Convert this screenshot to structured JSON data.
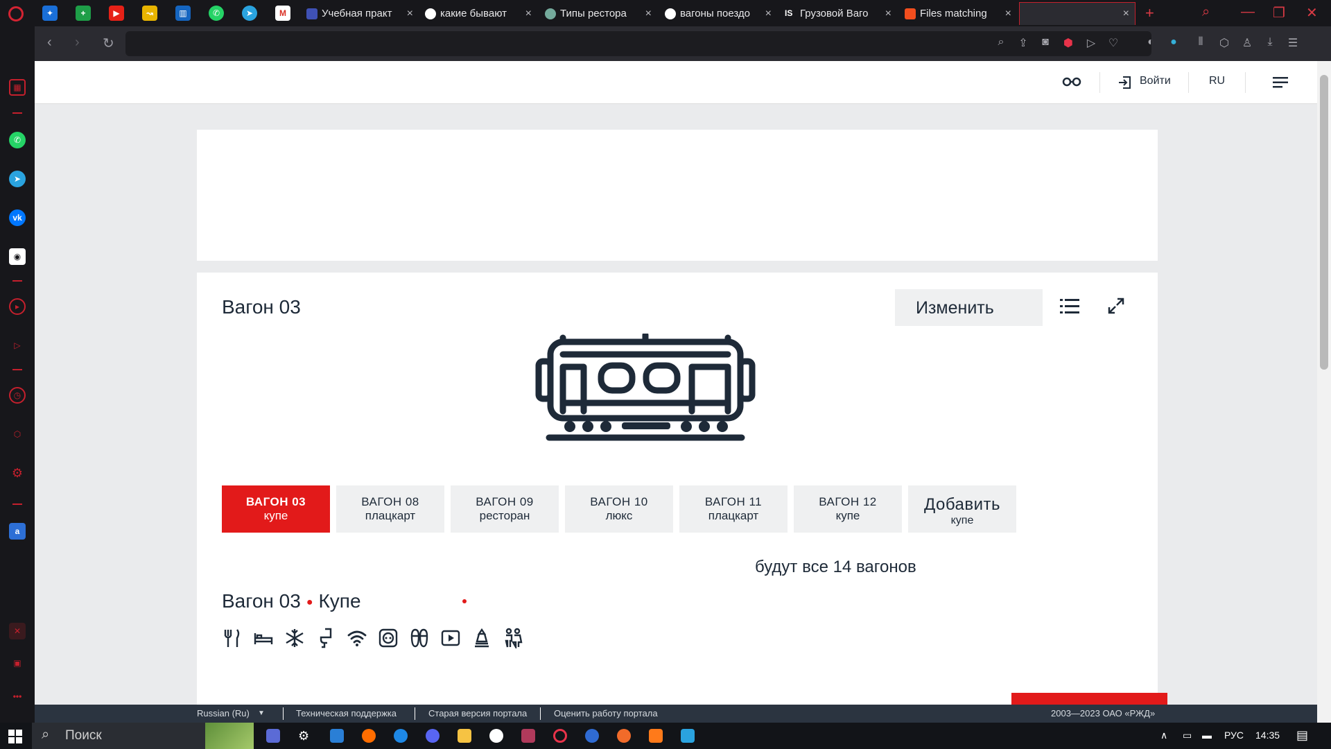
{
  "browser": {
    "tabs": [
      {
        "title": "Учебная практ",
        "icon_color": "#3f51b5"
      },
      {
        "title": "какие бывают",
        "icon_color": "#ffffff"
      },
      {
        "title": "Типы рестора",
        "icon_color": "#74aa9c"
      },
      {
        "title": "вагоны поездо",
        "icon_color": "#ffffff"
      },
      {
        "title": "Грузовой Ваго",
        "icon_color": "#17171b"
      },
      {
        "title": "Files matching",
        "icon_color": "#f24e1e"
      },
      {
        "title": "",
        "icon_color": "#2b2b31"
      }
    ],
    "close_glyph": "×",
    "new_tab": "+",
    "url": ""
  },
  "site": {
    "header": {
      "accessibility_icon": "glasses-icon",
      "login_label": "Войти",
      "lang_label": "RU",
      "menu_icon": "menu-icon"
    },
    "wagon": {
      "title": "Вагон 03",
      "edit_label": "Изменить",
      "tabs": [
        {
          "num": "ВАГОН 03",
          "kind": "купе",
          "selected": true
        },
        {
          "num": "ВАГОН 08",
          "kind": "плацкарт",
          "selected": false
        },
        {
          "num": "ВАГОН 09",
          "kind": "ресторан",
          "selected": false
        },
        {
          "num": "ВАГОН 10",
          "kind": "люкс",
          "selected": false
        },
        {
          "num": "ВАГОН 11",
          "kind": "плацкарт",
          "selected": false
        },
        {
          "num": "ВАГОН 12",
          "kind": "купе",
          "selected": false
        }
      ],
      "add_tab": {
        "num": "Добавить",
        "kind": "купе"
      },
      "note": "будут все 14 вагонов",
      "subtitle_a": "Вагон 03",
      "subtitle_b": "Купе",
      "amenities": [
        "food-icon",
        "bed-icon",
        "air-conditioning-icon",
        "toilet-icon",
        "wifi-icon",
        "socket-icon",
        "slippers-icon",
        "video-icon",
        "pet-icon",
        "family-icon"
      ]
    },
    "footer": {
      "language": "Russian (Ru)",
      "links": [
        "Техническая поддержка",
        "Старая версия портала",
        "Оценить работу портала"
      ],
      "copyright": "2003—2023 ОАО «РЖД»"
    }
  },
  "taskbar": {
    "search_placeholder": "Поиск",
    "lang": "РУС",
    "time": "14:35"
  },
  "colors": {
    "accent": "#e21a1a",
    "text": "#1e2a38",
    "opera_red": "#c5202d"
  }
}
